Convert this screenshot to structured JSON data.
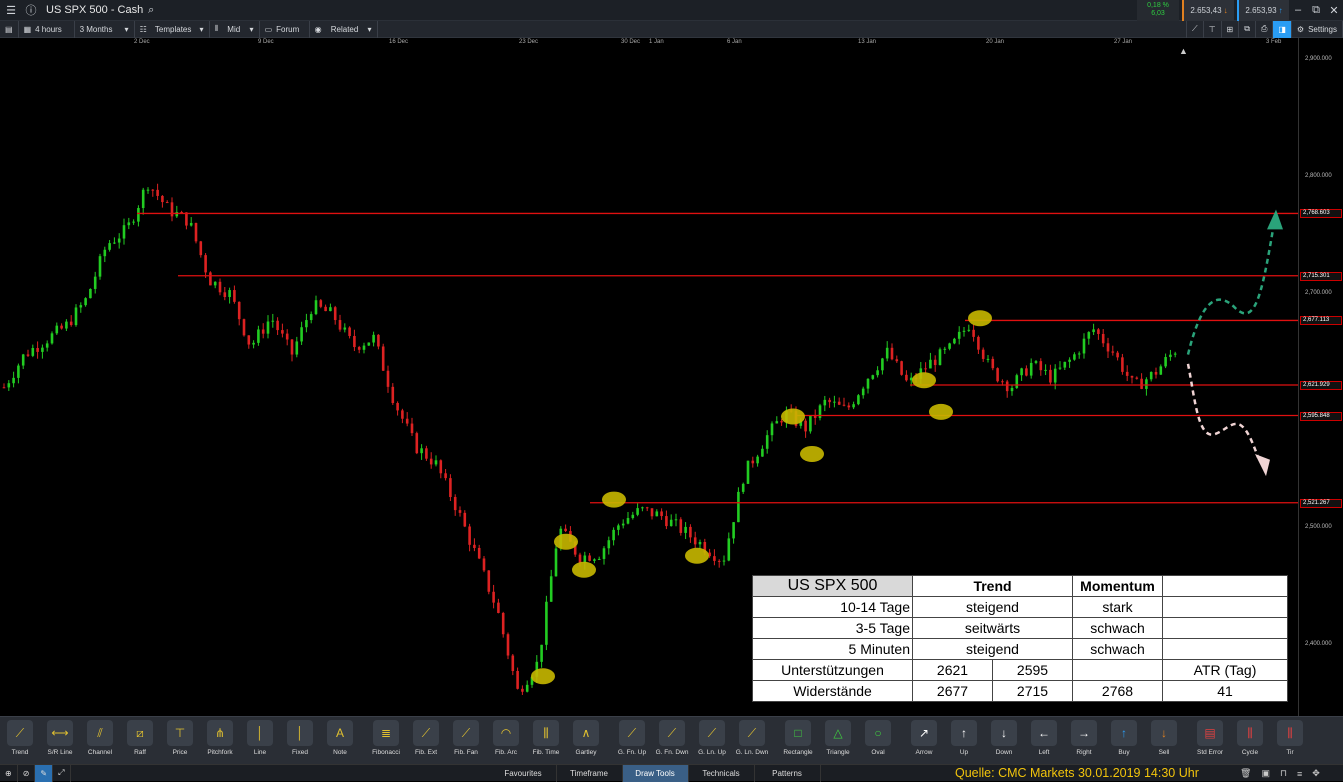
{
  "window": {
    "title": "US SPX 500 - Cash"
  },
  "header": {
    "change_pct": "0,18 %",
    "change_abs": "6,03",
    "sell_price": "2.653,43",
    "buy_price": "2.653,93",
    "colors": {
      "up": "#2ecc40",
      "sell": "#e08020",
      "buy": "#2a9df4"
    }
  },
  "toolbar": {
    "timeframe": "4 hours",
    "range": "3 Months",
    "templates": "Templates",
    "price_type": "Mid",
    "forum": "Forum",
    "related": "Related",
    "settings": "Settings"
  },
  "chart_data": {
    "type": "candlestick",
    "instrument": "US SPX 500",
    "date_ticks": [
      "2 Dec",
      "9 Dec",
      "16 Dec",
      "23 Dec",
      "30 Dec",
      "1 Jan",
      "6 Jan",
      "13 Jan",
      "20 Jan",
      "27 Jan",
      "3 Feb"
    ],
    "price_ticks": [
      "2,900.000",
      "2,800.000",
      "2,700.000",
      "2,500.000",
      "2,400.000"
    ],
    "ylim": [
      2339,
      2910
    ],
    "horizontal_lines": [
      {
        "value": 2768.603,
        "label": "2,768.603"
      },
      {
        "value": 2715.301,
        "label": "2,715.301"
      },
      {
        "value": 2677.113,
        "label": "2,677.113"
      },
      {
        "value": 2621.929,
        "label": "2,621.929"
      },
      {
        "value": 2595.848,
        "label": "2,595.848"
      },
      {
        "value": 2521.267,
        "label": "2,521.267"
      }
    ],
    "line_color": "#e01010",
    "up_color": "#22cc22",
    "down_color": "#dd2222",
    "marker_color": "#c8b800",
    "close_path": [
      2620,
      2648,
      2660,
      2672,
      2695,
      2742,
      2755,
      2795,
      2772,
      2762,
      2712,
      2700,
      2655,
      2680,
      2648,
      2690,
      2682,
      2655,
      2662,
      2608,
      2570,
      2555,
      2518,
      2475,
      2430,
      2360,
      2385,
      2500,
      2475,
      2478,
      2505,
      2515,
      2510,
      2498,
      2485,
      2472,
      2545,
      2575,
      2598,
      2585,
      2608,
      2600,
      2628,
      2650,
      2622,
      2640,
      2652,
      2675,
      2635,
      2620,
      2640,
      2628,
      2645,
      2670,
      2650,
      2620,
      2632,
      2652
    ]
  },
  "table": {
    "title": "US SPX 500",
    "col_trend": "Trend",
    "col_momentum": "Momentum",
    "rows": [
      {
        "label": "10-14 Tage",
        "trend": "steigend",
        "momentum": "stark"
      },
      {
        "label": "3-5 Tage",
        "trend": "seitwärts",
        "momentum": "schwach"
      },
      {
        "label": "5 Minuten",
        "trend": "steigend",
        "momentum": "schwach"
      }
    ],
    "support_label": "Unterstützungen",
    "support_1": "2621",
    "support_2": "2595",
    "resist_label": "Widerstände",
    "resist_1": "2677",
    "resist_2": "2715",
    "resist_3": "2768",
    "atr_label": "ATR (Tag)",
    "atr_value": "41"
  },
  "tools": [
    {
      "label": "Trend",
      "icon": "trend-icon"
    },
    {
      "label": "S/R Line",
      "icon": "sr-line-icon"
    },
    {
      "label": "Channel",
      "icon": "channel-icon"
    },
    {
      "label": "Raff",
      "icon": "raff-icon"
    },
    {
      "label": "Price",
      "icon": "price-icon"
    },
    {
      "label": "Pitchfork",
      "icon": "pitchfork-icon"
    },
    {
      "label": "Line",
      "icon": "line-icon"
    },
    {
      "label": "Fixed",
      "icon": "fixed-icon"
    },
    {
      "label": "Note",
      "icon": "note-icon"
    },
    {
      "label": "Fibonacci",
      "icon": "fibonacci-icon"
    },
    {
      "label": "Fib. Ext",
      "icon": "fib-ext-icon"
    },
    {
      "label": "Fib. Fan",
      "icon": "fib-fan-icon"
    },
    {
      "label": "Fib. Arc",
      "icon": "fib-arc-icon"
    },
    {
      "label": "Fib. Time",
      "icon": "fib-time-icon"
    },
    {
      "label": "Gartley",
      "icon": "gartley-icon"
    },
    {
      "label": "G. Fn. Up",
      "icon": "gann-fan-up-icon"
    },
    {
      "label": "G. Fn. Dwn",
      "icon": "gann-fan-down-icon"
    },
    {
      "label": "G. Ln. Up",
      "icon": "gann-line-up-icon"
    },
    {
      "label": "G. Ln. Dwn",
      "icon": "gann-line-down-icon"
    },
    {
      "label": "Rectangle",
      "icon": "rectangle-icon"
    },
    {
      "label": "Triangle",
      "icon": "triangle-icon"
    },
    {
      "label": "Oval",
      "icon": "oval-icon"
    },
    {
      "label": "Arrow",
      "icon": "arrow-icon"
    },
    {
      "label": "Up",
      "icon": "up-arrow-icon"
    },
    {
      "label": "Down",
      "icon": "down-arrow-icon"
    },
    {
      "label": "Left",
      "icon": "left-arrow-icon"
    },
    {
      "label": "Right",
      "icon": "right-arrow-icon"
    },
    {
      "label": "Buy",
      "icon": "buy-icon"
    },
    {
      "label": "Sell",
      "icon": "sell-icon"
    },
    {
      "label": "Std Error",
      "icon": "std-error-icon"
    },
    {
      "label": "Cycle",
      "icon": "cycle-icon"
    },
    {
      "label": "Tir",
      "icon": "tirone-icon"
    }
  ],
  "bottom_tabs": [
    "Favourites",
    "Timeframe",
    "Draw Tools",
    "Technicals",
    "Patterns"
  ],
  "active_tab": "Draw Tools",
  "source": "Quelle: CMC Markets 30.01.2019  14:30 Uhr"
}
